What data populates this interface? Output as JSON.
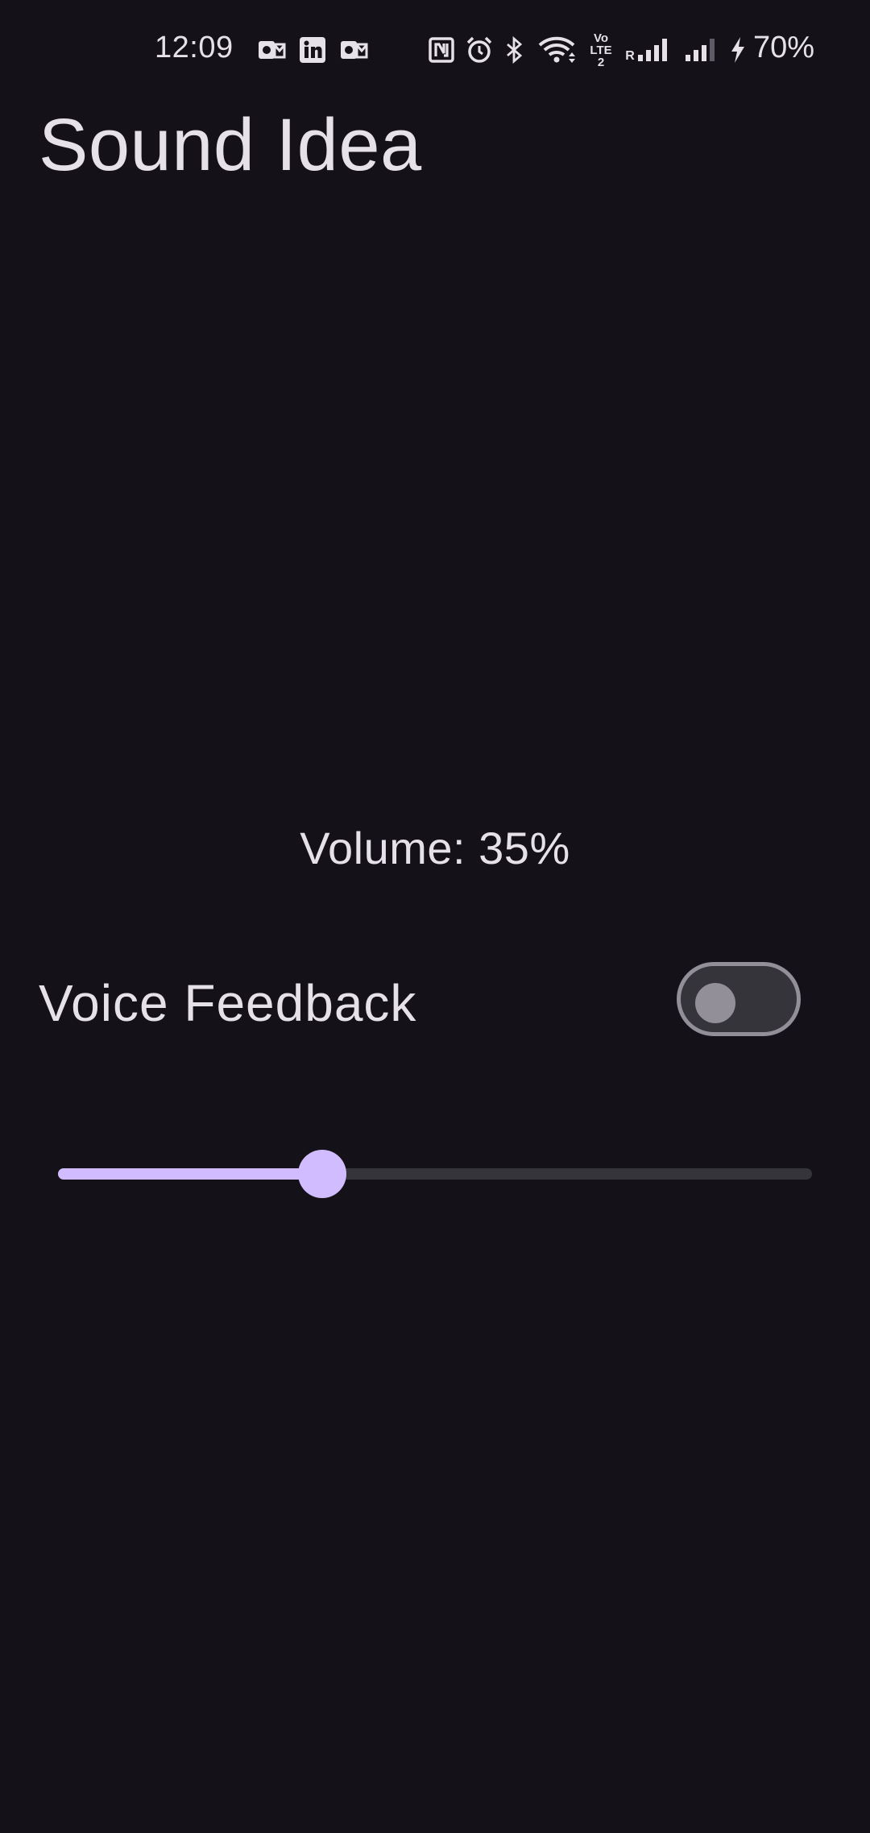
{
  "status_bar": {
    "time": "12:09",
    "battery": "70%",
    "icons": [
      "outlook-icon",
      "linkedin-icon",
      "outlook-icon",
      "nfc-icon",
      "alarm-icon",
      "bluetooth-icon",
      "wifi-icon",
      "volte-icon",
      "signal-roaming-icon",
      "signal-icon",
      "charging-icon"
    ],
    "volte_label": "Vo LTE2",
    "roaming_label": "R"
  },
  "app": {
    "title": "Sound Idea"
  },
  "volume": {
    "text": "Volume: 35%",
    "value_percent": 35
  },
  "voice_feedback": {
    "label": "Voice Feedback",
    "enabled": false
  },
  "colors": {
    "background": "#141218",
    "on_surface": "#E6E0E9",
    "primary": "#D0BCFF",
    "outline": "#938F99",
    "track_inactive": "#36343B"
  }
}
